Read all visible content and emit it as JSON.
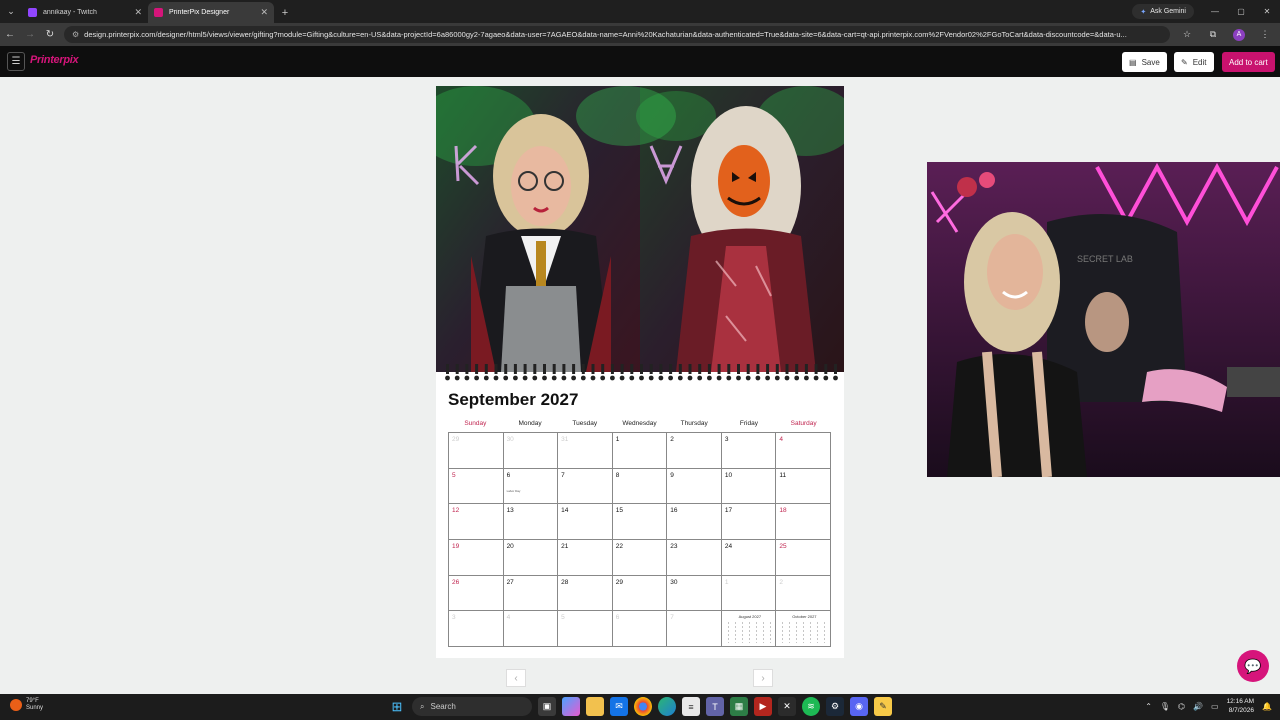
{
  "browser": {
    "tabs": [
      {
        "title": "annikaay - Twitch",
        "favicon_color": "#9146ff",
        "active": false
      },
      {
        "title": "PrinterPix Designer",
        "favicon_color": "#d5157a",
        "active": true
      }
    ],
    "gemini_label": "Ask Gemini",
    "url": "design.printerpix.com/designer/html5/views/viewer/gifting?module=Gifting&culture=en-US&data-projectId=6a86000gy2-7agaeo&data-user=7AGAEO&data-name=Anni%20Kachaturian&data-authenticated=True&data-site=6&data-cart=qt-api.printerpix.com%2FVendor02%2FGoToCart&data-discountcode=&data-u...",
    "profile_initial": "A"
  },
  "app": {
    "logo": "Printerpix",
    "save_label": "Save",
    "edit_label": "Edit",
    "cart_label": "Add to cart"
  },
  "calendar": {
    "month_title": "September 2027",
    "weekdays": [
      "Sunday",
      "Monday",
      "Tuesday",
      "Wednesday",
      "Thursday",
      "Friday",
      "Saturday"
    ],
    "holiday_label": "Labor Day",
    "prev_mini": "August 2027",
    "next_mini": "October 2027",
    "weeks": [
      [
        "29",
        "30",
        "31",
        "1",
        "2",
        "3",
        "4"
      ],
      [
        "5",
        "6",
        "7",
        "8",
        "9",
        "10",
        "11"
      ],
      [
        "12",
        "13",
        "14",
        "15",
        "16",
        "17",
        "18"
      ],
      [
        "19",
        "20",
        "21",
        "22",
        "23",
        "24",
        "25"
      ],
      [
        "26",
        "27",
        "28",
        "29",
        "30",
        "1",
        "2"
      ],
      [
        "3",
        "4",
        "5",
        "6",
        "7",
        "",
        ""
      ]
    ]
  },
  "taskbar": {
    "temperature": "79°F",
    "condition": "Sunny",
    "search_label": "Search",
    "time": "12:16 AM",
    "date": "8/7/2026"
  },
  "colors": {
    "brand": "#d5157a",
    "weekend": "#c0244f"
  }
}
